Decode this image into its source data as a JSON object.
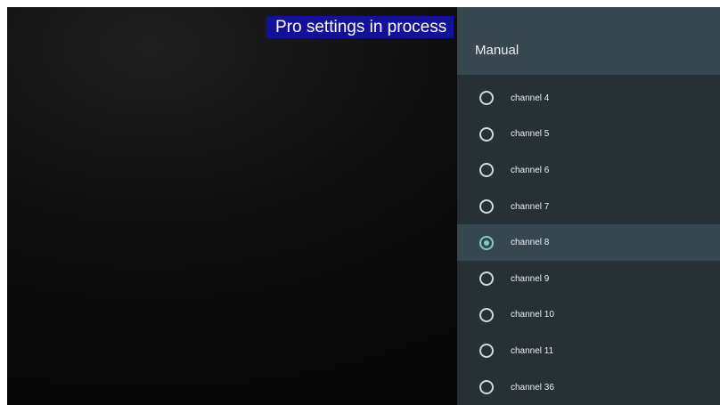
{
  "banner": {
    "text": "Pro settings in process"
  },
  "panel": {
    "title": "Manual",
    "items": [
      {
        "label": "channel 4",
        "selected": false
      },
      {
        "label": "channel 5",
        "selected": false
      },
      {
        "label": "channel 6",
        "selected": false
      },
      {
        "label": "channel 7",
        "selected": false
      },
      {
        "label": "channel 8",
        "selected": true
      },
      {
        "label": "channel 9",
        "selected": false
      },
      {
        "label": "channel 10",
        "selected": false
      },
      {
        "label": "channel 11",
        "selected": false
      },
      {
        "label": "channel 36",
        "selected": false
      }
    ]
  },
  "colors": {
    "banner_bg": "#11119a",
    "panel_bg": "#263035",
    "header_bg": "#37474f",
    "selected_accent": "#80cbc4"
  }
}
